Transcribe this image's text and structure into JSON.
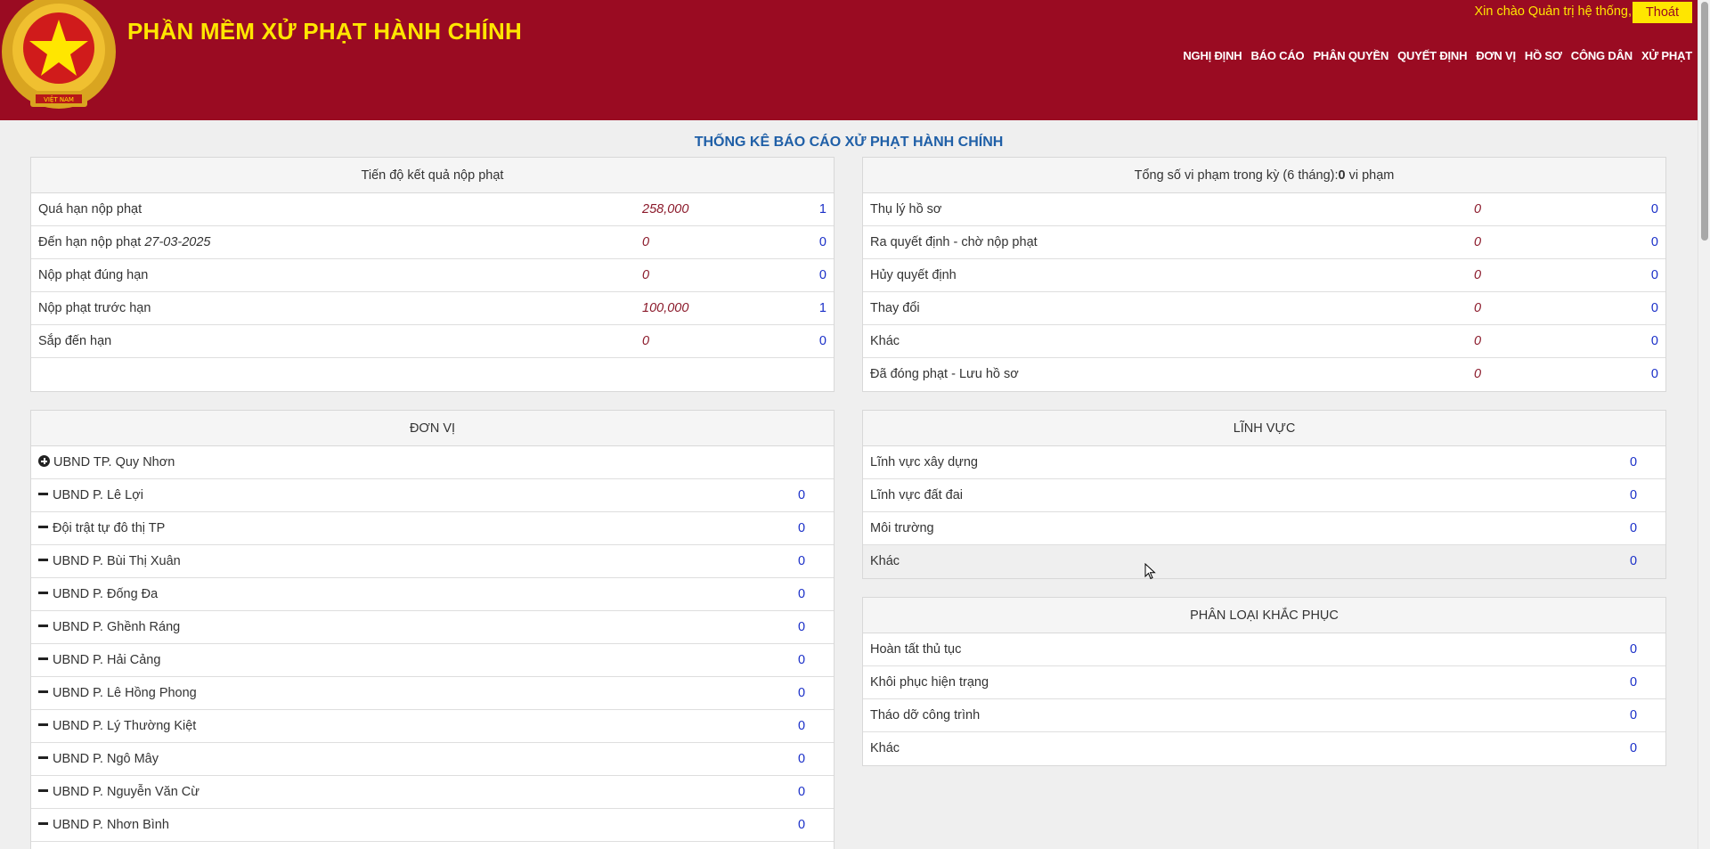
{
  "header": {
    "app_title": "PHẦN MỀM XỬ PHẠT HÀNH CHÍNH",
    "greeting": "Xin chào Quản trị hệ thống,",
    "logout_label": "Thoát",
    "emblem_text": "VIỆT NAM",
    "nav": [
      "NGHỊ ĐỊNH",
      "BÁO CÁO",
      "PHÂN QUYỀN",
      "QUYẾT ĐỊNH",
      "ĐƠN VỊ",
      "HỒ SƠ",
      "CÔNG DÂN",
      "XỬ PHẠT"
    ]
  },
  "page_title": "THỐNG KÊ BÁO CÁO XỬ PHẠT HÀNH CHÍNH",
  "progress": {
    "title": "Tiến độ kết quả nộp phạt",
    "rows": [
      {
        "label": "Quá hạn nộp phạt",
        "date": "",
        "amount": "258,000",
        "count": "1"
      },
      {
        "label": "Đến hạn nộp phạt",
        "date": "27-03-2025",
        "amount": "0",
        "count": "0"
      },
      {
        "label": "Nộp phạt đúng hạn",
        "date": "",
        "amount": "0",
        "count": "0"
      },
      {
        "label": "Nộp phạt trước hạn",
        "date": "",
        "amount": "100,000",
        "count": "1"
      },
      {
        "label": "Sắp đến hạn",
        "date": "",
        "amount": "0",
        "count": "0"
      }
    ]
  },
  "violations": {
    "title_prefix": "Tổng số vi phạm trong kỳ (6 tháng):",
    "title_count": "0",
    "title_suffix": " vi phạm",
    "rows": [
      {
        "label": "Thụ lý hồ sơ",
        "amount": "0",
        "count": "0"
      },
      {
        "label": "Ra quyết định - chờ nộp phạt",
        "amount": "0",
        "count": "0"
      },
      {
        "label": "Hủy quyết định",
        "amount": "0",
        "count": "0"
      },
      {
        "label": "Thay đổi",
        "amount": "0",
        "count": "0"
      },
      {
        "label": "Khác",
        "amount": "0",
        "count": "0"
      },
      {
        "label": "Đã đóng phạt - Lưu hồ sơ",
        "amount": "0",
        "count": "0"
      }
    ]
  },
  "units": {
    "title": "ĐƠN VỊ",
    "root": "UBND TP. Quy Nhơn",
    "rows": [
      {
        "label": "UBND P. Lê Lợi",
        "count": "0"
      },
      {
        "label": "Đội trật tự đô thị TP",
        "count": "0"
      },
      {
        "label": "UBND P. Bùi Thị Xuân",
        "count": "0"
      },
      {
        "label": "UBND P. Đống Đa",
        "count": "0"
      },
      {
        "label": "UBND P. Ghềnh Ráng",
        "count": "0"
      },
      {
        "label": "UBND P. Hải Cảng",
        "count": "0"
      },
      {
        "label": "UBND P. Lê Hồng Phong",
        "count": "0"
      },
      {
        "label": "UBND P. Lý Thường Kiệt",
        "count": "0"
      },
      {
        "label": "UBND P. Ngô Mây",
        "count": "0"
      },
      {
        "label": "UBND P. Nguyễn Văn Cừ",
        "count": "0"
      },
      {
        "label": "UBND P. Nhơn Bình",
        "count": "0"
      }
    ]
  },
  "fields": {
    "title": "LĨNH VỰC",
    "rows": [
      {
        "label": "Lĩnh vực xây dựng",
        "count": "0"
      },
      {
        "label": "Lĩnh vực đất đai",
        "count": "0"
      },
      {
        "label": "Môi trường",
        "count": "0"
      },
      {
        "label": "Khác",
        "count": "0"
      }
    ]
  },
  "remedy": {
    "title": "PHÂN LOẠI KHẮC PHỤC",
    "rows": [
      {
        "label": "Hoàn tất thủ tục",
        "count": "0"
      },
      {
        "label": "Khôi phục hiện trạng",
        "count": "0"
      },
      {
        "label": "Tháo dỡ công trình",
        "count": "0"
      },
      {
        "label": "Khác",
        "count": "0"
      }
    ]
  },
  "colors": {
    "header_bg": "#9a0b22",
    "title_yellow": "#ffe600",
    "amount_red": "#8b1a2b",
    "count_blue": "#1a2fc8",
    "page_title_blue": "#1f5fa7"
  }
}
